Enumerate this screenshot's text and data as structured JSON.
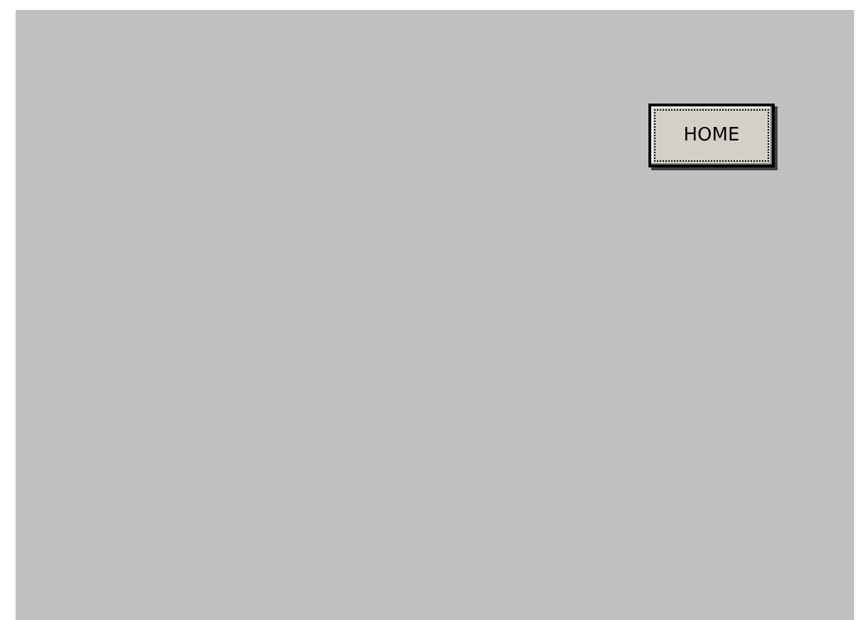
{
  "buttons": [
    {
      "label": "HOME",
      "focused": true
    }
  ]
}
